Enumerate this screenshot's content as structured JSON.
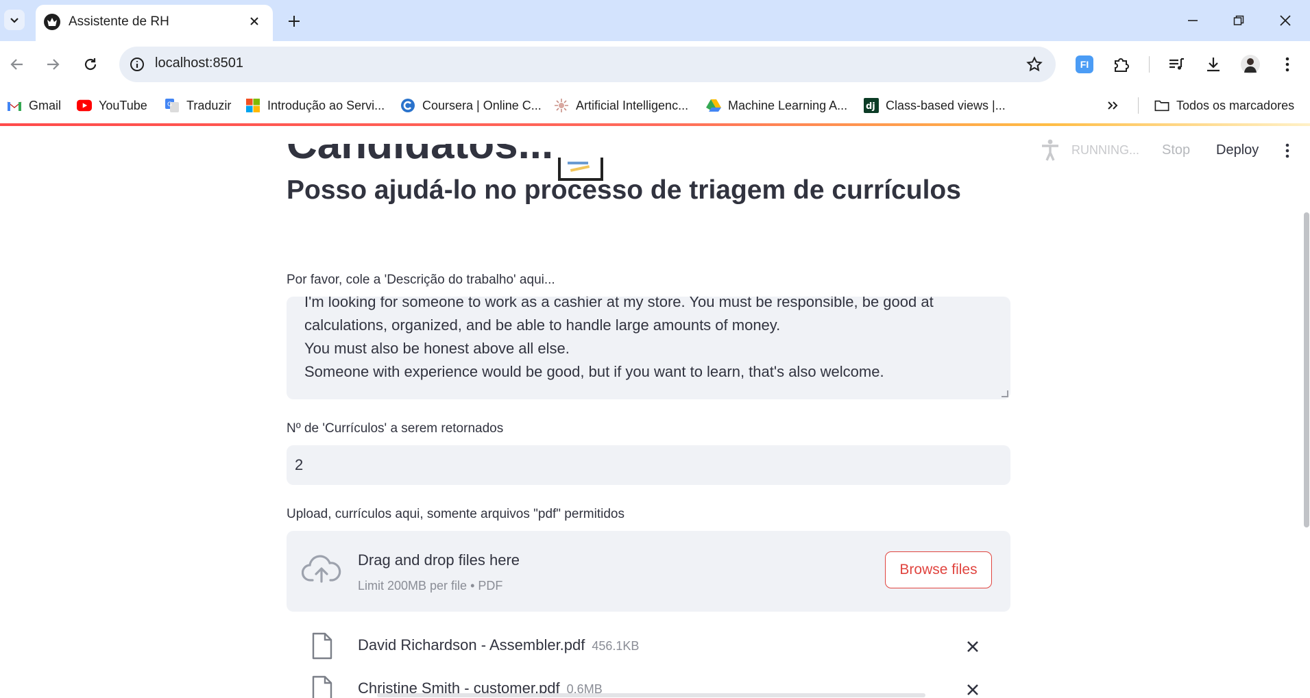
{
  "browser": {
    "tab_title": "Assistente de RH",
    "url": "localhost:8501",
    "bookmarks": [
      {
        "label": "Gmail",
        "icon": "gmail-icon"
      },
      {
        "label": "YouTube",
        "icon": "youtube-icon"
      },
      {
        "label": "Traduzir",
        "icon": "translate-icon"
      },
      {
        "label": "Introdução ao Servi...",
        "icon": "microsoft-icon"
      },
      {
        "label": "Coursera | Online C...",
        "icon": "coursera-icon"
      },
      {
        "label": "Artificial Intelligenc...",
        "icon": "ai-icon"
      },
      {
        "label": "Machine Learning A...",
        "icon": "drive-icon"
      },
      {
        "label": "Class-based views |...",
        "icon": "django-icon"
      }
    ],
    "all_bookmarks_label": "Todos os marcadores",
    "extension_label": "FI"
  },
  "streamlit_header": {
    "status": "RUNNING...",
    "stop_label": "Stop",
    "deploy_label": "Deploy"
  },
  "main": {
    "title": "Candidatos...",
    "subtitle": "Posso ajudá-lo no processo de triagem de currículos",
    "job_description": {
      "label": "Por favor, cole a 'Descrição do trabalho' aqui...",
      "lines": [
        "I'm looking for someone to work as a cashier at my store. You must be responsible, be good at",
        "calculations, organized, and be able to handle large amounts of money.",
        "You must also be honest above all else.",
        "Someone with experience would be good, but if you want to learn, that's also welcome."
      ]
    },
    "resume_count": {
      "label": "Nº de 'Currículos' a serem retornados",
      "value": "2"
    },
    "upload": {
      "label": "Upload, currículos aqui, somente arquivos \"pdf\" permitidos",
      "drop_title": "Drag and drop files here",
      "limit": "Limit 200MB per file • PDF",
      "browse_label": "Browse files",
      "files": [
        {
          "name": "David Richardson - Assembler.pdf",
          "size": "456.1KB"
        },
        {
          "name": "Christine Smith - customer.pdf",
          "size": "0.6MB"
        }
      ]
    }
  },
  "colors": {
    "accent": "#ff4b4b",
    "chrome_tabbar": "#d3e3fd",
    "input_bg": "#f0f2f6",
    "text": "#31333f"
  }
}
